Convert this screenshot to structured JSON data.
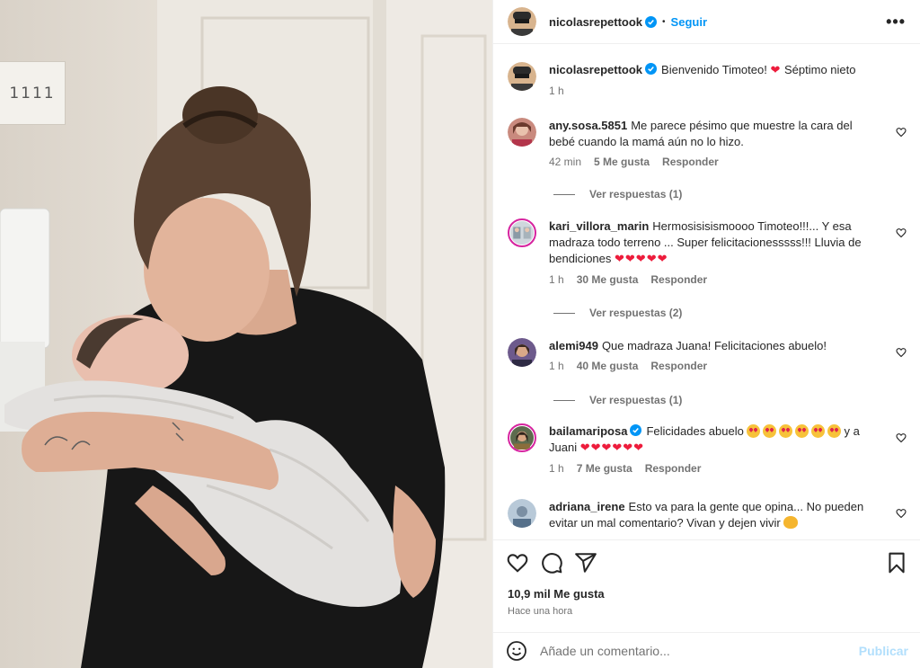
{
  "post": {
    "author": "nicolasrepettook",
    "follow_label": "Seguir",
    "more_label": "•••",
    "door_sign": "1111",
    "caption": {
      "username": "nicolasrepettook",
      "text_before": "Bienvenido Timoteo!",
      "heart": "❤",
      "text_after": "Séptimo nieto",
      "time": "1 h"
    }
  },
  "comments": [
    {
      "username": "any.sosa.5851",
      "text": "Me parece pésimo que muestre la cara del bebé cuando la mamá aún no lo hizo.",
      "time": "42 min",
      "likes": "5 Me gusta",
      "reply": "Responder",
      "view_replies": "Ver respuestas (1)"
    },
    {
      "username": "kari_villora_marin",
      "text": "Hermosisisismoooo Timoteo!!!... Y esa madraza todo terreno ... Super felicitacionesssss!!! Lluvia de bendiciones",
      "hearts": "❤❤❤❤❤",
      "time": "1 h",
      "likes": "30 Me gusta",
      "reply": "Responder",
      "view_replies": "Ver respuestas (2)"
    },
    {
      "username": "alemi949",
      "text": "Que madraza Juana! Felicitaciones abuelo!",
      "time": "1 h",
      "likes": "40 Me gusta",
      "reply": "Responder",
      "view_replies": "Ver respuestas (1)"
    },
    {
      "username": "bailamariposa",
      "text_before": "Felicidades abuelo",
      "text_mid": "y a Juani",
      "hearts": "❤❤❤❤❤❤",
      "time": "1 h",
      "likes": "7 Me gusta",
      "reply": "Responder"
    },
    {
      "username": "adriana_irene",
      "text": "Esto va para la gente que opina... No pueden evitar un mal comentario? Vivan y dejen vivir"
    }
  ],
  "stats": {
    "likes": "10,9 mil Me gusta",
    "time": "Hace una hora"
  },
  "composer": {
    "placeholder": "Añade un comentario...",
    "publish_label": "Publicar"
  },
  "colors": {
    "accent": "#0095f6",
    "verified": "#0095f6",
    "heart": "#ed1c3c",
    "publish_disabled": "#b2dffc"
  }
}
